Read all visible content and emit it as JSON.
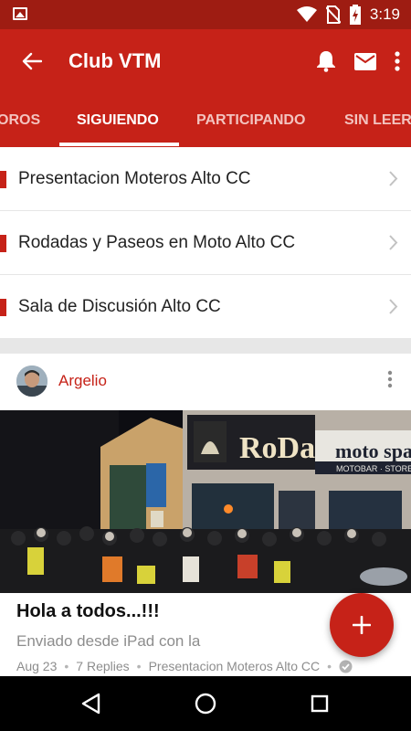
{
  "status_bar": {
    "time": "3:19",
    "icons": [
      "picture-icon",
      "wifi-icon",
      "no-sim-icon",
      "battery-charging-icon"
    ]
  },
  "app_bar": {
    "title": "Club VTM",
    "back_icon": "arrow-left-icon",
    "actions": [
      "bell-icon",
      "mail-icon",
      "more-vertical-icon"
    ]
  },
  "tabs": [
    {
      "label": "OROS",
      "active": false
    },
    {
      "label": "SIGUIENDO",
      "active": true
    },
    {
      "label": "PARTICIPANDO",
      "active": false
    },
    {
      "label": "SIN LEER",
      "active": false
    }
  ],
  "forums": [
    {
      "label": "Presentacion Moteros Alto CC"
    },
    {
      "label": "Rodadas y Paseos en Moto Alto CC"
    },
    {
      "label": "Sala de Discusión Alto CC"
    }
  ],
  "post": {
    "author": "Argelio",
    "image_signs": {
      "left_sign": "RoDaR",
      "right_sign": "moto spa",
      "right_subsign": "MOTOBAR · STORE"
    },
    "title": "Hola a todos...!!!",
    "snippet": "Enviado desde iPad con la",
    "date": "Aug 23",
    "replies": "7 Replies",
    "forum": "Presentacion Moteros Alto CC"
  },
  "fab": {
    "icon": "plus-icon"
  },
  "nav": [
    "back-triangle-icon",
    "home-circle-icon",
    "recents-square-icon"
  ],
  "colors": {
    "primary": "#c62218",
    "primary_dark": "#9e1c12",
    "text": "#222222",
    "muted": "#8d8d8d"
  }
}
